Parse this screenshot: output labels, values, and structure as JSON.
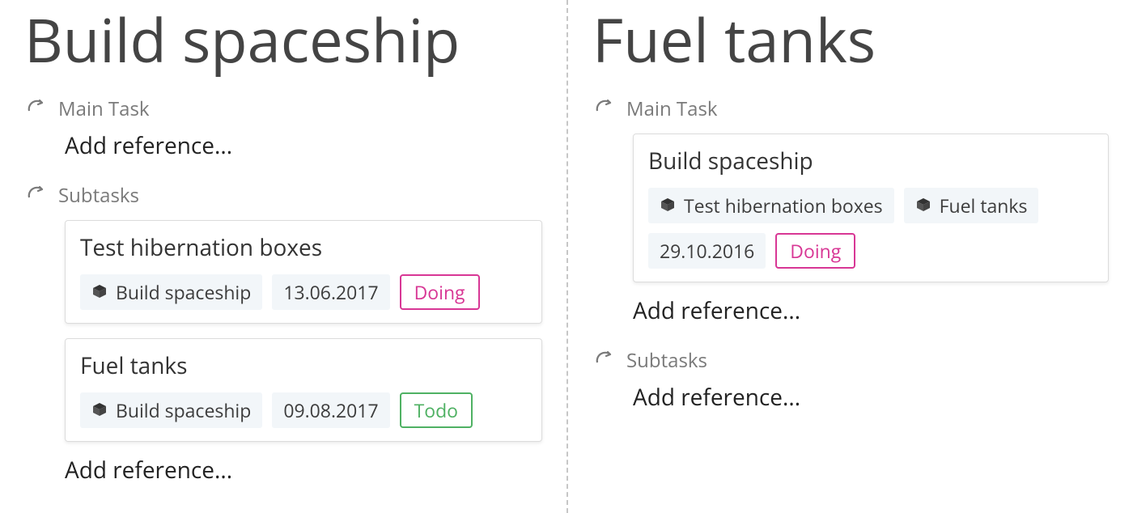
{
  "left": {
    "title": "Build spaceship",
    "sections": {
      "main": {
        "label": "Main Task",
        "add": "Add reference..."
      },
      "subtasks": {
        "label": "Subtasks",
        "add": "Add reference...",
        "cards": [
          {
            "title": "Test hibernation boxes",
            "refs": [
              {
                "label": "Build spaceship"
              }
            ],
            "date": "13.06.2017",
            "status": {
              "label": "Doing",
              "kind": "doing"
            }
          },
          {
            "title": "Fuel tanks",
            "refs": [
              {
                "label": "Build spaceship"
              }
            ],
            "date": "09.08.2017",
            "status": {
              "label": "Todo",
              "kind": "todo"
            }
          }
        ]
      }
    }
  },
  "right": {
    "title": "Fuel tanks",
    "sections": {
      "main": {
        "label": "Main Task",
        "add": "Add reference...",
        "cards": [
          {
            "title": "Build spaceship",
            "refs": [
              {
                "label": "Test hibernation boxes"
              },
              {
                "label": "Fuel tanks"
              }
            ],
            "date": "29.10.2016",
            "status": {
              "label": "Doing",
              "kind": "doing"
            }
          }
        ]
      },
      "subtasks": {
        "label": "Subtasks",
        "add": "Add reference..."
      }
    }
  }
}
